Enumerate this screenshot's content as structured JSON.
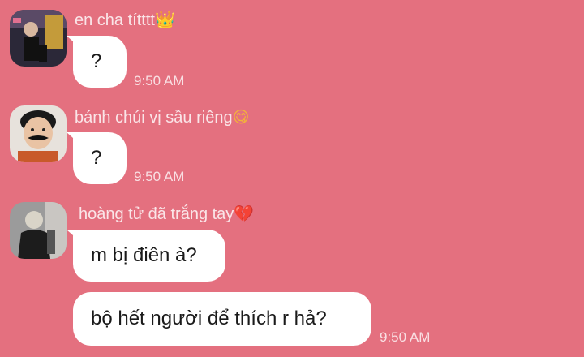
{
  "messages": [
    {
      "sender": "en cha títttt",
      "sender_emoji": "👑",
      "bubbles": [
        "?"
      ],
      "time": "9:50 AM"
    },
    {
      "sender": "bánh chúi vị sầu riêng",
      "sender_emoji": "😋",
      "bubbles": [
        "?"
      ],
      "time": "9:50 AM"
    },
    {
      "sender": "hoàng tử đã trắng tay",
      "sender_emoji": "💔",
      "bubbles": [
        "m bị điên à?",
        "bộ hết người để thích r hả?"
      ],
      "time": "9:50 AM"
    }
  ],
  "colors": {
    "background": "#e4707f",
    "bubble": "#ffffff",
    "crown": "#f3b13b",
    "heart": "#e23d7a"
  }
}
